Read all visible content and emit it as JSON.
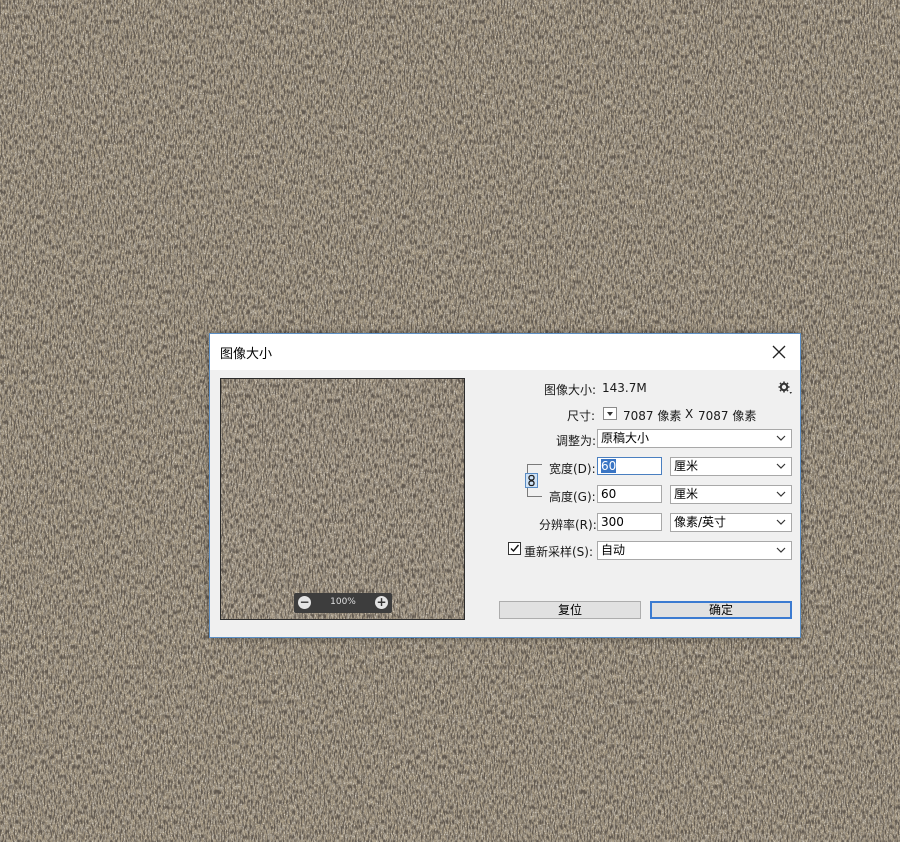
{
  "dialog": {
    "title": "图像大小",
    "image_size_label": "图像大小:",
    "image_size_value": "143.7M",
    "dimensions_label": "尺寸:",
    "dimensions_width": "7087 像素",
    "dimensions_sep": "X",
    "dimensions_height": "7087 像素",
    "fit_label": "调整为:",
    "fit_value": "原稿大小",
    "width_label": "宽度(D):",
    "width_value": "60",
    "width_unit": "厘米",
    "height_label": "高度(G):",
    "height_value": "60",
    "height_unit": "厘米",
    "resolution_label": "分辨率(R):",
    "resolution_value": "300",
    "resolution_unit": "像素/英寸",
    "resample_label": "重新采样(S):",
    "resample_checked": true,
    "resample_value": "自动",
    "reset_button": "复位",
    "ok_button": "确定"
  },
  "preview": {
    "zoom_label": "100%",
    "zoom_out": "−",
    "zoom_in": "+"
  },
  "icons": {
    "close": "close-icon",
    "gear": "gear-icon",
    "link": "link-icon",
    "dimension_dropdown": "dropdown-triangle-icon",
    "select_chevron": "chevron-down-icon",
    "checkbox_check": "check-icon"
  },
  "colors": {
    "dialog_bg": "#f0f0f0",
    "titlebar_bg": "#ffffff",
    "dialog_border": "#5b8fc6",
    "primary_button_border": "#3b7bd1",
    "selection_highlight": "#3a75c4",
    "texture_light": "#c8bca8",
    "texture_dark": "#2e2820"
  }
}
